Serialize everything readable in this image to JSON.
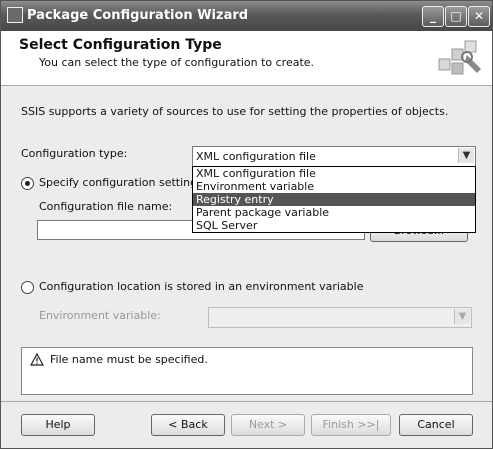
{
  "window": {
    "title": "Package Configuration Wizard",
    "minimize": "_",
    "maximize": "□",
    "close": "✕"
  },
  "header": {
    "title": "Select Configuration Type",
    "subtitle": "You can select the type of configuration to create."
  },
  "body": {
    "intro": "SSIS supports a variety of sources to use for setting the properties of objects.",
    "config_type_label": "Configuration type:",
    "config_type_value": "XML configuration file",
    "config_type_options": [
      "XML configuration file",
      "Environment variable",
      "Registry entry",
      "Parent package variable",
      "SQL Server"
    ],
    "config_type_highlighted": "Registry entry",
    "radio_specify_label": "Specify configuration settings di",
    "file_name_label": "Configuration file name:",
    "file_name_value": "",
    "browse_label": "Browse...",
    "radio_env_label": "Configuration location is stored in an environment variable",
    "env_var_label": "Environment variable:",
    "env_var_value": ""
  },
  "message": {
    "text": "File name must be specified."
  },
  "footer": {
    "help": "Help",
    "back": "< Back",
    "next": "Next >",
    "finish": "Finish >>|",
    "cancel": "Cancel"
  }
}
